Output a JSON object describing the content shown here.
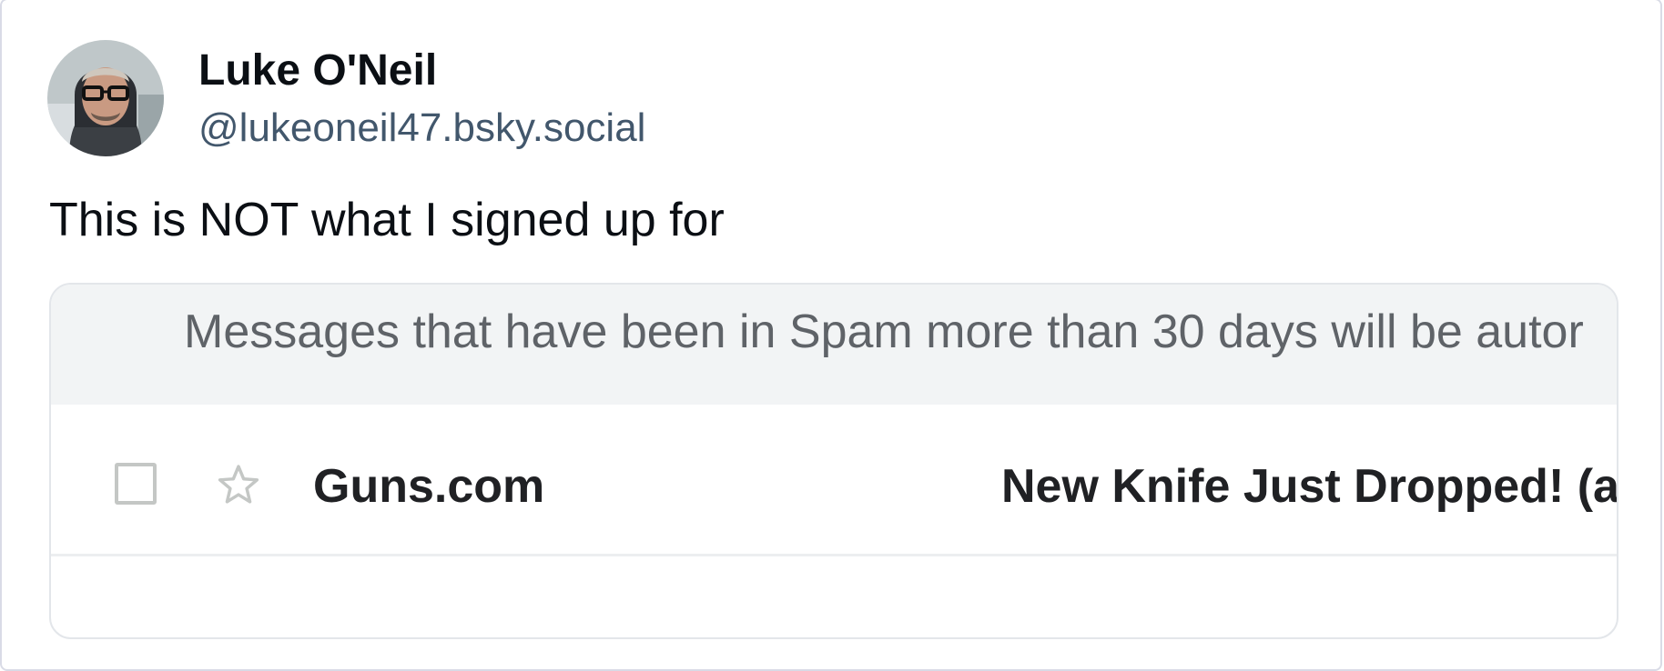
{
  "post": {
    "author": {
      "name": "Luke O'Neil",
      "handle": "@lukeoneil47.bsky.social",
      "avatar_icon": "profile-photo"
    },
    "text": "This is NOT what I signed up for"
  },
  "embed": {
    "spam_notice": "Messages that have been in Spam more than 30 days will be autor",
    "email_row": {
      "checkbox_checked": false,
      "starred": false,
      "star_icon": "star-outline-icon",
      "sender": "Guns.com",
      "subject": "New Knife Just Dropped! (a"
    }
  },
  "colors": {
    "name": "#0b0f14",
    "handle": "#42576c",
    "banner_bg": "#f2f4f5",
    "banner_text": "#5f6368",
    "mail_text": "#202124"
  }
}
